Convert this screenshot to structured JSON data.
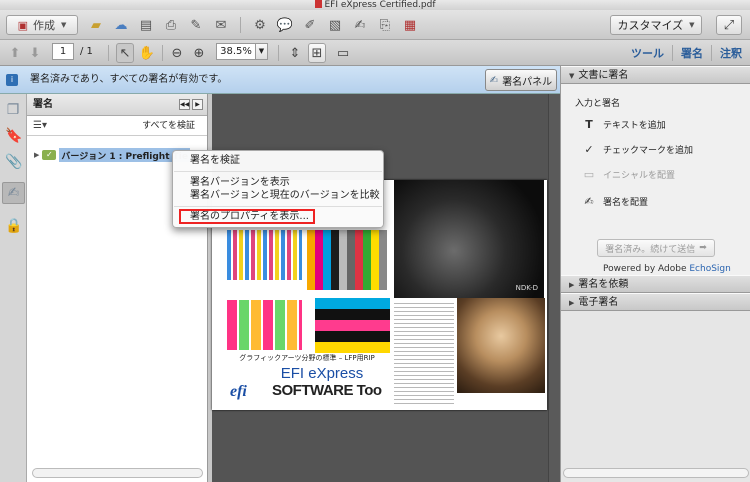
{
  "title": "EFI eXpress Certified.pdf",
  "toolbar": {
    "create_label": "作成",
    "customize_label": "カスタマイズ",
    "page_current": "1",
    "page_total": "/ 1",
    "zoom": "38.5%",
    "tabs": [
      "ツール",
      "署名",
      "注釈"
    ]
  },
  "sigbar": {
    "message": "署名済みであり、すべての署名が有効です。",
    "panel_button": "署名パネル"
  },
  "sig_panel": {
    "title": "署名",
    "validate_all": "すべてを検証",
    "version_label": "バージョン 1 : Preflight Tie"
  },
  "context_menu": {
    "items": [
      "署名を検証",
      "署名バージョンを表示",
      "署名バージョンと現在のバージョンを比較",
      "署名のプロパティを表示..."
    ]
  },
  "document": {
    "caption": "グラフィックアーツ分野の標準 – LFP用RIP",
    "efi_title": "EFI eXpress",
    "efi_logo": "efi",
    "software": "SOFTWARE Too",
    "moto_tag": "NDK-D"
  },
  "right_panel": {
    "section_title": "文書に署名",
    "input_label": "入力と署名",
    "items": [
      "テキストを追加",
      "チェックマークを追加",
      "イニシャルを配置",
      "署名を配置"
    ],
    "send_button": "署名済み。続けて送信",
    "powered_by": "Powered by Adobe",
    "echosign": "EchoSign",
    "request": "署名を依頼",
    "esign": "電子署名"
  },
  "colors": {
    "accent_blue": "#2a5d9a",
    "highlight_red": "#e22222",
    "selection": "#9dc0e6"
  }
}
